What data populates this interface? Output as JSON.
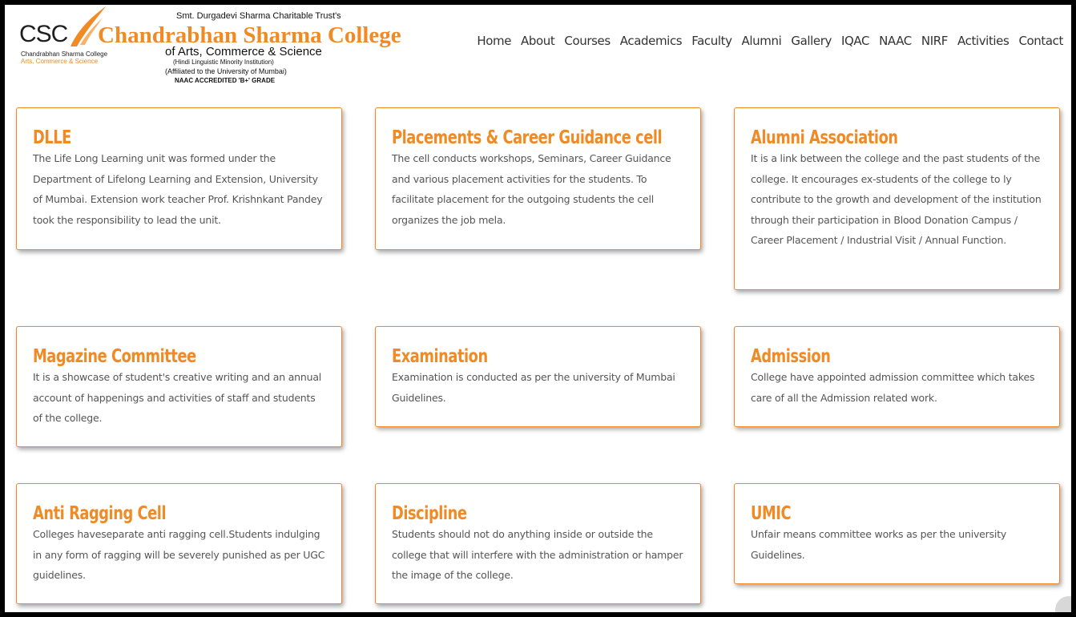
{
  "header": {
    "trust": "Smt. Durgadevi Sharma Charitable Trust's",
    "logo_abbr": "CSC",
    "college_name": "Chandrabhan Sharma College",
    "subtitle": "of Arts, Commerce & Science",
    "small_name": "Chandrabhan Sharma College",
    "small_sub": "Arts, Commerce & Science",
    "minority": "(Hindi Linguistic Minority Institution)",
    "affiliation": "(Affiliated to the University of Mumbai)",
    "accreditation": "NAAC ACCREDITED 'B+' GRADE",
    "accent_color": "#f08a24"
  },
  "nav": [
    "Home",
    "About",
    "Courses",
    "Academics",
    "Faculty",
    "Alumni",
    "Gallery",
    "IQAC",
    "NAAC",
    "NIRF",
    "Activities",
    "Contact"
  ],
  "cards": [
    {
      "title": "DLLE",
      "text": "The Life Long Learning unit was formed under the Department of Lifelong Learning and Extension, University of Mumbai. Extension work teacher Prof. Krishnkant Pandey took the responsibility to lead the unit."
    },
    {
      "title": "Placements & Career Guidance cell",
      "text": "The cell conducts workshops, Seminars, Career Guidance and various placement activities for the students. To facilitate placement for the outgoing students the cell organizes the job mela."
    },
    {
      "title": "Alumni Association",
      "text": "It is a link between the college and the past students of the college. It encourages ex-students of the college to ly contribute to the growth and development of the institution through their participation in Blood Donation Campus / Career Placement / Industrial Visit / Annual Function."
    },
    {
      "title": "Magazine Committee",
      "text": "It is a showcase of student's creative writing and an annual account of happenings and activities of staff and students of the college."
    },
    {
      "title": "Examination",
      "text": "Examination is conducted as per the university of Mumbai Guidelines."
    },
    {
      "title": "Admission",
      "text": "College have appointed admission committee which takes care of all the Admission related work."
    },
    {
      "title": "Anti Ragging Cell",
      "text": "Colleges haveseparate anti ragging cell.Students indulging in any form of ragging will be severely punished as per UGC guidelines."
    },
    {
      "title": "Discipline",
      "text": "Students should not do anything inside or outside the college that will interfere with the administration or hamper the image of the college."
    },
    {
      "title": "UMIC",
      "text": "Unfair means committee works as per the university Guidelines."
    }
  ]
}
